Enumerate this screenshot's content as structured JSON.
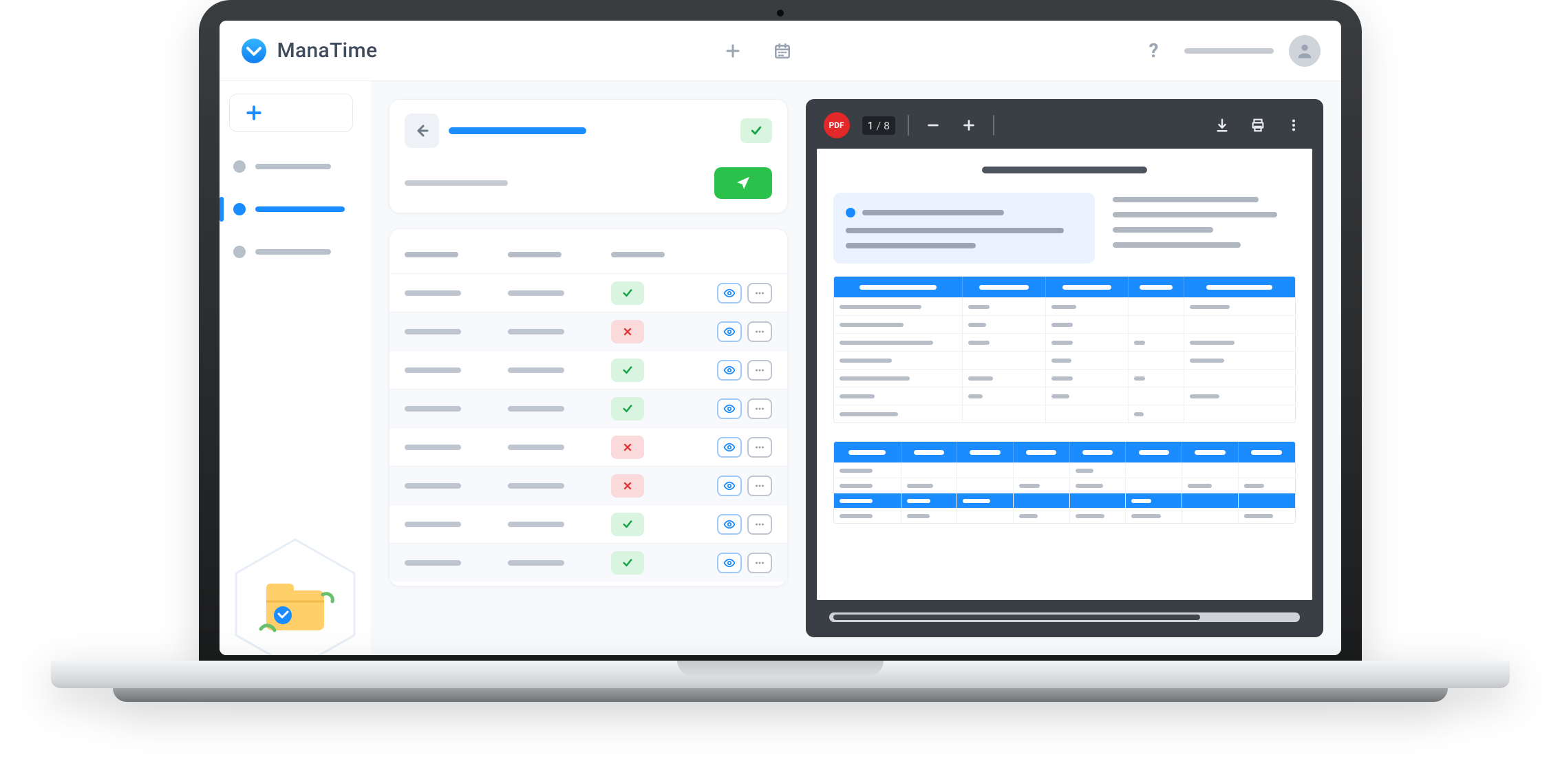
{
  "brand": {
    "name": "ManaTime"
  },
  "topbar": {
    "add_icon": "plus-icon",
    "calendar_icon": "calendar-icon",
    "help_label": "?",
    "avatar_icon": "user-icon"
  },
  "sidebar": {
    "add_icon": "plus-icon",
    "items": [
      {
        "active": false
      },
      {
        "active": true
      },
      {
        "active": false
      }
    ]
  },
  "header_card": {
    "back_icon": "arrow-left-icon",
    "status_icon": "check-icon",
    "send_icon": "paper-plane-icon"
  },
  "table": {
    "columns": 3,
    "rows": [
      {
        "status": "ok"
      },
      {
        "status": "bad"
      },
      {
        "status": "ok"
      },
      {
        "status": "ok"
      },
      {
        "status": "bad"
      },
      {
        "status": "bad"
      },
      {
        "status": "ok"
      },
      {
        "status": "ok"
      }
    ],
    "eye_icon": "eye-icon",
    "more_icon": "ellipsis-icon",
    "check_icon": "check-icon",
    "x_icon": "x-icon"
  },
  "pdf": {
    "badge": "PDF",
    "page_current": "1",
    "page_sep": "/",
    "page_total": "8",
    "zoom_out_icon": "minus-icon",
    "zoom_in_icon": "plus-icon",
    "download_icon": "download-icon",
    "print_icon": "print-icon",
    "menu_icon": "kebab-icon",
    "table1": {
      "cols": 5,
      "rows": 7
    },
    "table2": {
      "cols": 8,
      "rows": 4,
      "highlight_row_index": 2
    }
  },
  "colors": {
    "accent": "#1b8cff",
    "success": "#2bc24c",
    "success_soft": "#d9f5df",
    "danger_soft": "#fadada",
    "pdf_bezel": "#3a3f46"
  }
}
